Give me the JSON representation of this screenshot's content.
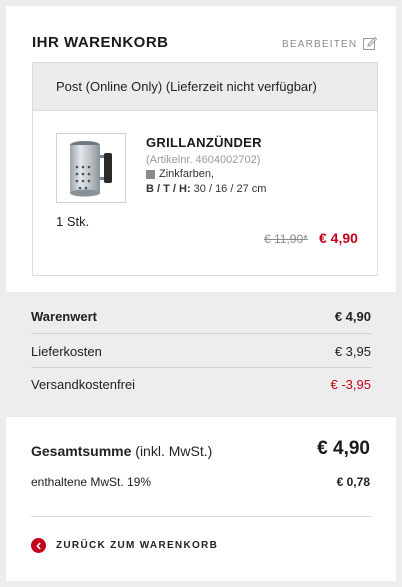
{
  "cart": {
    "title": "IHR WARENKORB",
    "edit_label": "BEARBEITEN"
  },
  "shipping_box": {
    "header": "Post (Online Only) (Lieferzeit nicht verfügbar)"
  },
  "product": {
    "name": "GRILLANZÜNDER",
    "article": "(Artikelnr. 4604002702)",
    "color": "Zinkfarben,",
    "color_swatch": "#8c8c8c",
    "dims_label": "B / T / H:",
    "dims_value": " 30 / 16 / 27 cm",
    "quantity": "1 Stk.",
    "old_price": "€ 11,90*",
    "new_price": "€ 4,90"
  },
  "summary": {
    "goods_label": "Warenwert",
    "goods_value": "€ 4,90",
    "delivery_label": "Lieferkosten",
    "delivery_value": "€ 3,95",
    "free_shipping_label": "Versandkostenfrei",
    "free_shipping_value": "€ -3,95"
  },
  "totals": {
    "total_label": "Gesamtsumme",
    "total_suffix": " (inkl. MwSt.)",
    "total_value": "€ 4,90",
    "vat_label": "enthaltene MwSt. 19%",
    "vat_value": "€ 0,78"
  },
  "back": {
    "label": "ZURÜCK ZUM WARENKORB"
  },
  "colors": {
    "accent_red": "#c4001a",
    "background": "#ededed"
  },
  "icons": {
    "edit": "pencil-square-icon",
    "back": "chevron-left-circle-icon"
  }
}
